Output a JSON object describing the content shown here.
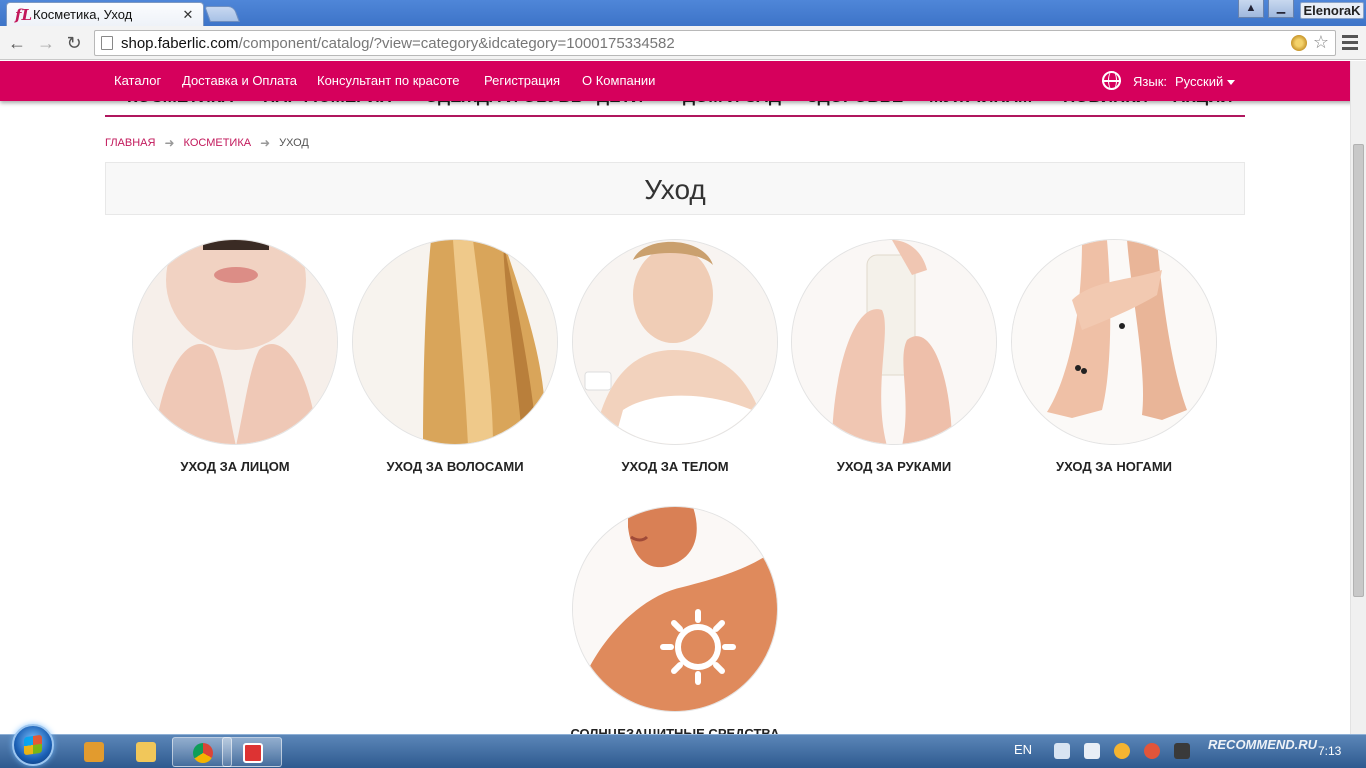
{
  "browser": {
    "tab_title": "Косметика, Уход",
    "tab_favicon": "fL",
    "user_name": "ElenoraK",
    "url_host": "shop.faberlic.com",
    "url_path": "/component/catalog/?view=category&idcategory=1000175334582"
  },
  "topnav": {
    "links": [
      "Каталог",
      "Доставка и Оплата",
      "Консультант по красоте",
      "Регистрация",
      "О Компании"
    ],
    "lang_label": "Язык:",
    "lang_value": "Русский"
  },
  "category_menu": [
    "КОСМЕТИКА",
    "ПАРФЮМЕРИЯ",
    "ОДЕЖДА И ОБУВЬ",
    "ДЕТИ",
    "ДОМ И САД",
    "ЗДОРОВЬЕ",
    "МУЖЧИНАМ",
    "НОВИНКИ",
    "АКЦИИ"
  ],
  "breadcrumb": {
    "home": "ГЛАВНАЯ",
    "parent": "КОСМЕТИКА",
    "current": "УХОД"
  },
  "page_title": "Уход",
  "categories": [
    {
      "label": "УХОД ЗА ЛИЦОМ"
    },
    {
      "label": "УХОД ЗА ВОЛОСАМИ"
    },
    {
      "label": "УХОД ЗА ТЕЛОМ"
    },
    {
      "label": "УХОД ЗА РУКАМИ"
    },
    {
      "label": "УХОД ЗА НОГАМИ"
    },
    {
      "label": "СОЛНЦЕЗАЩИТНЫЕ СРЕДСТВА"
    }
  ],
  "taskbar": {
    "lang": "EN",
    "clock": "7:13",
    "watermark": "RECOMMEND.RU"
  },
  "colors": {
    "brand": "#d6005c",
    "breadcrumb_link": "#c2185b"
  }
}
